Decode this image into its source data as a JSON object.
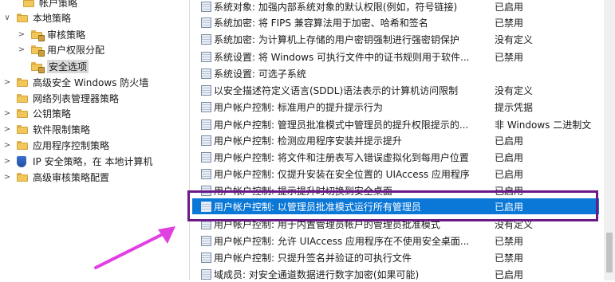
{
  "tree": {
    "items": [
      {
        "label": "帐户策略",
        "expander": "",
        "icon": "folder-icon"
      },
      {
        "label": "本地策略",
        "expander": "∨",
        "icon": "folder-icon"
      },
      {
        "label": "审核策略",
        "expander": ">",
        "icon": "folder-icon"
      },
      {
        "label": "用户权限分配",
        "expander": ">",
        "icon": "folder-icon"
      },
      {
        "label": "安全选项",
        "expander": "",
        "icon": "folder-open-icon"
      },
      {
        "label": "高级安全 Windows 防火墙",
        "expander": ">",
        "icon": "folder-icon"
      },
      {
        "label": "网络列表管理器策略",
        "expander": "",
        "icon": "folder-icon"
      },
      {
        "label": "公钥策略",
        "expander": ">",
        "icon": "folder-icon"
      },
      {
        "label": "软件限制策略",
        "expander": ">",
        "icon": "folder-icon"
      },
      {
        "label": "应用程序控制策略",
        "expander": ">",
        "icon": "folder-icon"
      },
      {
        "label": "IP 安全策略，在 本地计算机",
        "expander": ">",
        "icon": "shield-icon"
      },
      {
        "label": "高级审核策略配置",
        "expander": ">",
        "icon": "folder-icon"
      }
    ]
  },
  "policies": [
    {
      "name": "系统对象: 加强内部系统对象的默认权限(例如，符号链接)",
      "value": "已启用"
    },
    {
      "name": "系统加密: 将 FIPS 兼容算法用于加密、哈希和签名",
      "value": "已禁用"
    },
    {
      "name": "系统加密: 为计算机上存储的用户密钥强制进行强密钥保护",
      "value": "没有定义"
    },
    {
      "name": "系统设置: 将 Windows 可执行文件中的证书规则用于软件...",
      "value": "已禁用"
    },
    {
      "name": "系统设置: 可选子系统",
      "value": ""
    },
    {
      "name": "以安全描述符定义语言(SDDL)语法表示的计算机访问限制",
      "value": "没有定义"
    },
    {
      "name": "用户帐户控制: 标准用户的提升提示行为",
      "value": "提示凭据"
    },
    {
      "name": "用户帐户控制: 管理员批准模式中管理员的提升权限提示的...",
      "value": "非 Windows 二进制文"
    },
    {
      "name": "用户帐户控制: 检测应用程序安装并提示提升",
      "value": "已启用"
    },
    {
      "name": "用户帐户控制: 将文件和注册表写入错误虚拟化到每用户位置",
      "value": "已启用"
    },
    {
      "name": "用户帐户控制: 仅提升安装在安全位置的 UIAccess 应用程序",
      "value": "已启用"
    },
    {
      "name": "用户帐户控制: 提示提升时切换到安全桌面",
      "value": "已启用"
    },
    {
      "name": "用户帐户控制: 以管理员批准模式运行所有管理员",
      "value": "已启用"
    },
    {
      "name": "用户帐户控制: 用于内置管理员帐户的管理员批准模式",
      "value": "没有定义"
    },
    {
      "name": "用户帐户控制: 允许 UIAccess 应用程序在不使用安全桌面...",
      "value": "已禁用"
    },
    {
      "name": "用户帐户控制: 只提升签名并验证的可执行文件",
      "value": "已禁用"
    },
    {
      "name": "域成员: 对安全通道数据进行数字加密(如果可能)",
      "value": "已启用"
    }
  ],
  "colors": {
    "selection": "#0b78d7",
    "annotation_box": "#6a1a88",
    "arrow": "#e040e0"
  }
}
